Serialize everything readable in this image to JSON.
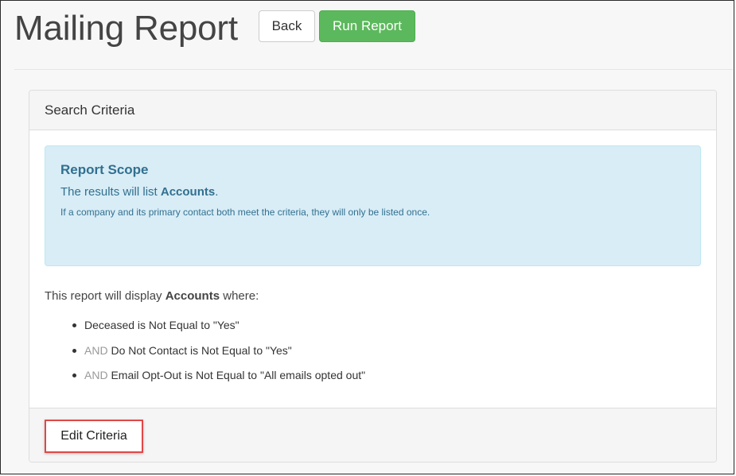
{
  "header": {
    "title": "Mailing Report",
    "back_label": "Back",
    "run_label": "Run Report"
  },
  "panel": {
    "heading": "Search Criteria",
    "alert": {
      "title": "Report Scope",
      "line_prefix": "The results will list ",
      "line_bold": "Accounts",
      "line_suffix": ".",
      "note": "If a company and its primary contact both meet the criteria, they will only be listed once."
    },
    "display": {
      "prefix": "This report will display ",
      "bold": "Accounts",
      "suffix": " where:"
    },
    "criteria": [
      {
        "connector": "",
        "text": "Deceased is Not Equal to \"Yes\""
      },
      {
        "connector": "AND",
        "text": "Do Not Contact is Not Equal to \"Yes\""
      },
      {
        "connector": "AND",
        "text": "Email Opt-Out is Not Equal to \"All emails opted out\""
      }
    ],
    "footer": {
      "edit_label": "Edit Criteria"
    }
  },
  "colors": {
    "run_button": "#5cb85c",
    "alert_bg": "#d9edf7",
    "alert_text": "#31708f",
    "highlight_border": "#e04848"
  }
}
